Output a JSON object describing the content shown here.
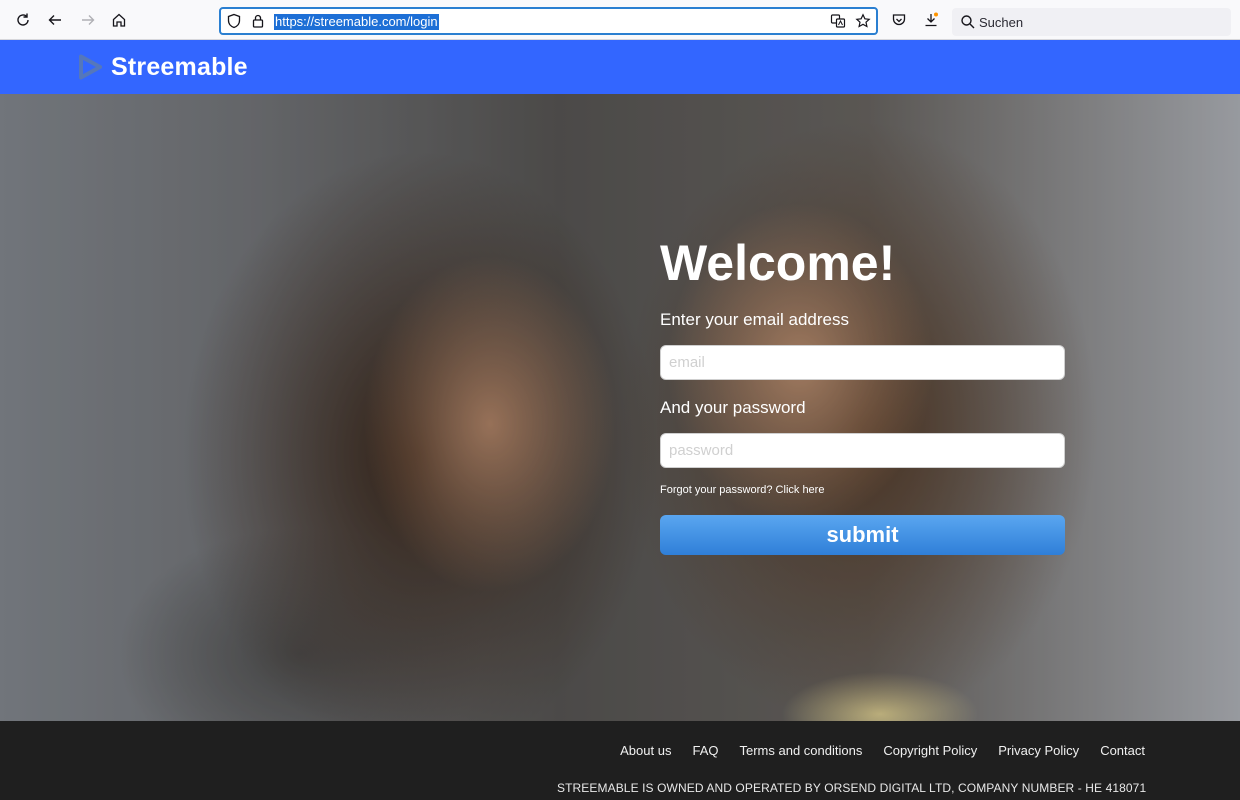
{
  "browser": {
    "url": "https://streemable.com/login",
    "search_placeholder": "Suchen"
  },
  "site": {
    "brand": "Streemable",
    "accent_color": "#3366ff"
  },
  "login": {
    "heading": "Welcome!",
    "email_label": "Enter your email address",
    "email_placeholder": "email",
    "email_value": "",
    "password_label": "And your password",
    "password_placeholder": "password",
    "password_value": "",
    "forgot_text": "Forgot your password? Click here",
    "submit_label": "submit"
  },
  "footer": {
    "links": [
      "About us",
      "FAQ",
      "Terms and conditions",
      "Copyright Policy",
      "Privacy Policy",
      "Contact"
    ],
    "legal": "STREEMABLE IS OWNED AND OPERATED BY ORSEND DIGITAL LTD, COMPANY NUMBER - HE 418071"
  }
}
